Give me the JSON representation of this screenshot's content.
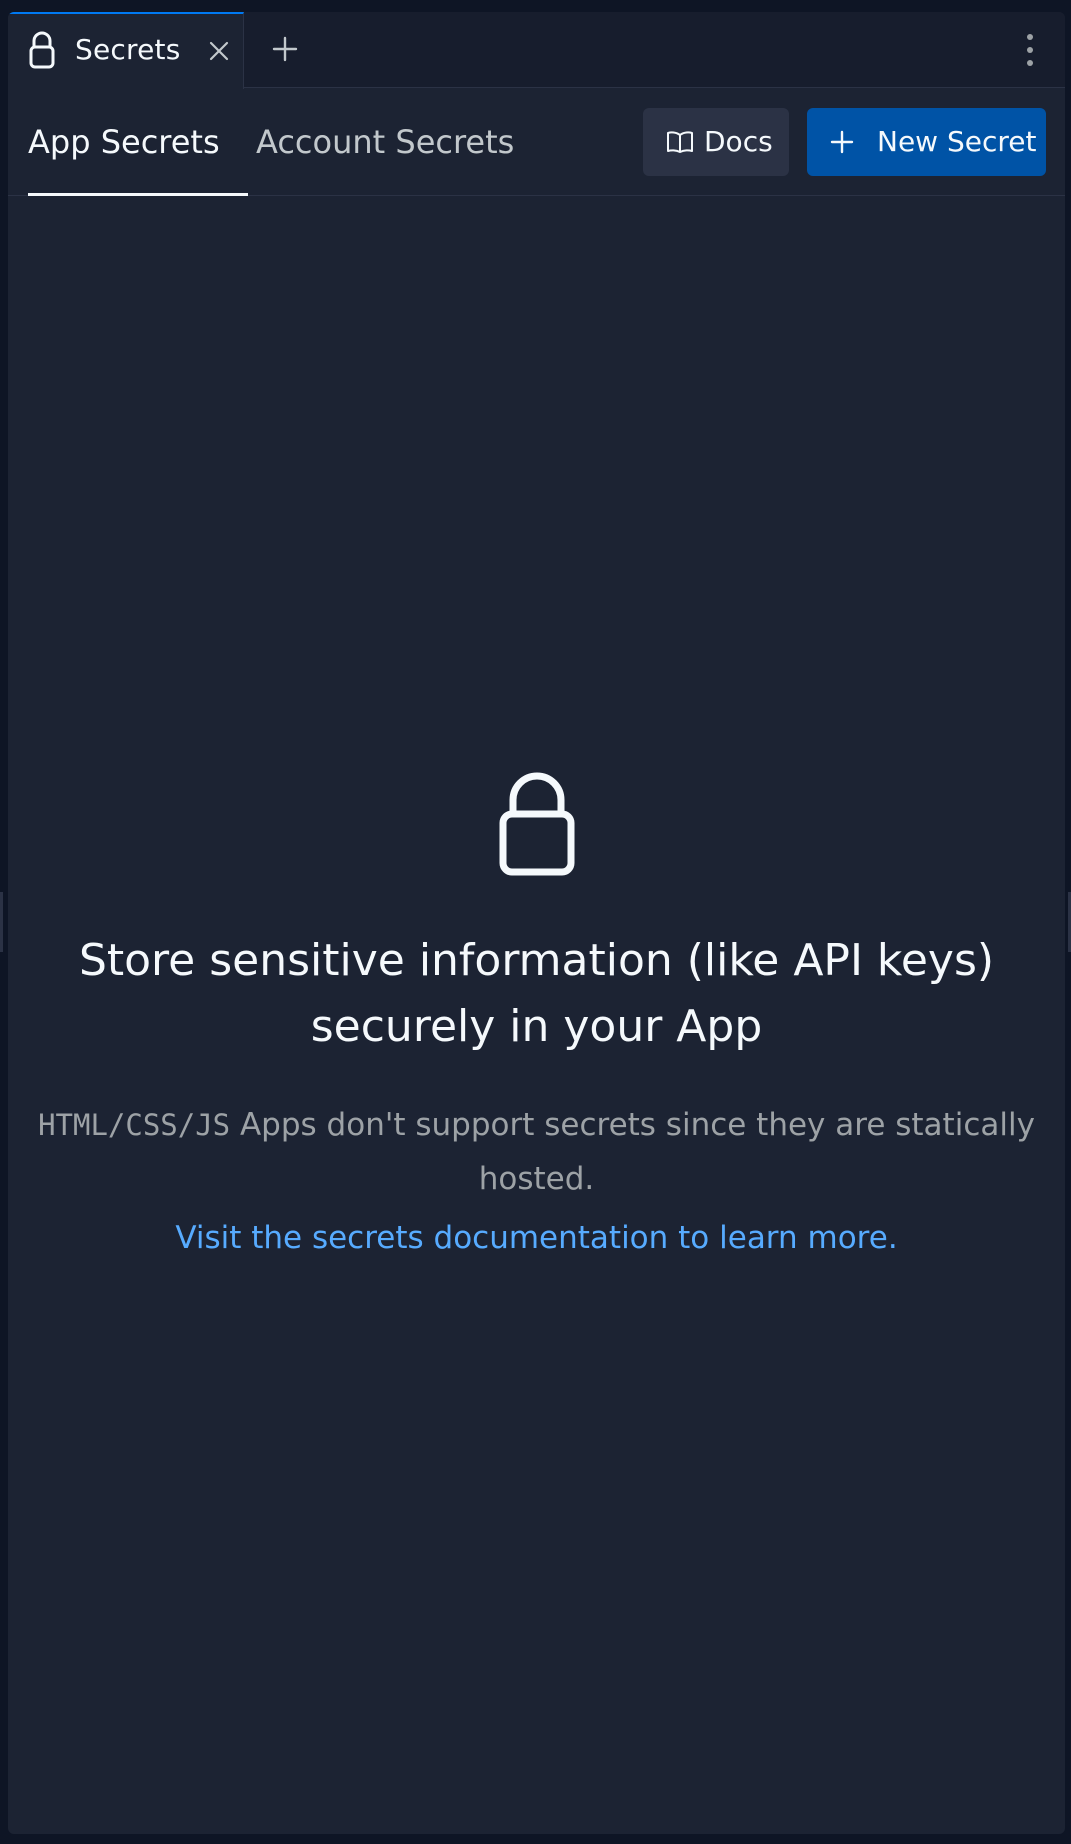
{
  "tab": {
    "title": "Secrets",
    "icon": "lock-icon",
    "close_icon": "close-icon",
    "add_icon": "plus-icon",
    "menu_icon": "more-vertical-icon"
  },
  "subtabs": [
    {
      "label": "App Secrets",
      "active": true
    },
    {
      "label": "Account Secrets",
      "active": false
    }
  ],
  "actions": {
    "docs_label": "Docs",
    "docs_icon": "book-icon",
    "new_secret_label": "New Secret",
    "new_secret_icon": "plus-icon"
  },
  "empty_state": {
    "icon": "lock-icon",
    "headline": "Store sensitive information (like API keys) securely in your App",
    "code_text": "HTML/CSS/JS",
    "description": " Apps don't support secrets since they are statically hosted.",
    "link_text": "Visit the secrets documentation to learn more."
  },
  "colors": {
    "background": "#1c2333",
    "accent": "#0079f2",
    "primary_button": "#0053a6",
    "link": "#57abff"
  }
}
